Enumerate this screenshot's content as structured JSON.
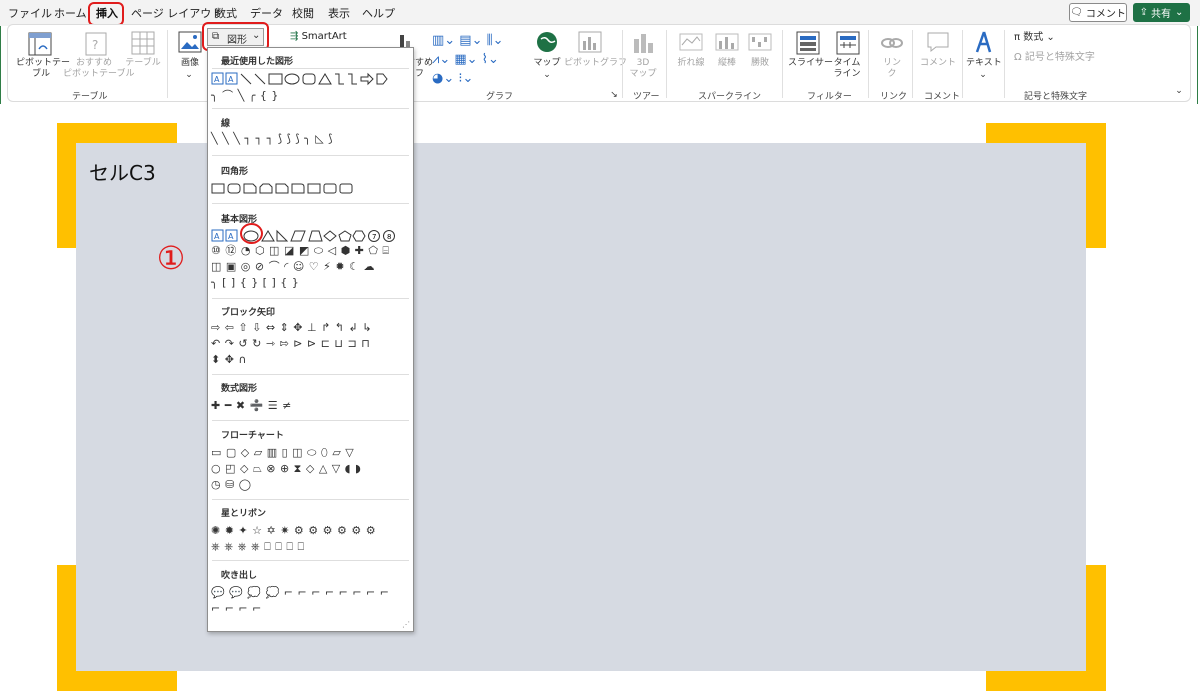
{
  "menu": {
    "tabs": [
      "ファイル",
      "ホーム",
      "挿入",
      "ページ レイアウト",
      "数式",
      "データ",
      "校閲",
      "表示",
      "ヘルプ"
    ],
    "active_tab": "挿入",
    "comment_btn": "コメント",
    "share_btn": "共有"
  },
  "ribbon": {
    "pivot_table": "ピボットテー\nブル",
    "recommended_pivot": "おすすめ\nピボットテーブル",
    "table": "テーブル",
    "group_table": "テーブル",
    "image": "画像",
    "shapes_btn": "図形",
    "smartart": "SmartArt",
    "recommended_chart": "すすめ\nラフ",
    "map": "マップ",
    "pivot_chart": "ピボットグラフ",
    "group_chart": "グラフ",
    "map3d": "3D\nマップ",
    "group_tour": "ツアー",
    "line": "折れ線",
    "column": "縦棒",
    "winloss": "勝敗",
    "group_spark": "スパークライン",
    "slicer": "スライサー",
    "timeline": "タイム\nライン",
    "group_filter": "フィルター",
    "link": "リン\nク",
    "group_link": "リンク",
    "comment": "コメント",
    "group_comment": "コメント",
    "text": "テキスト",
    "equation": "数式",
    "symbol": "記号と特殊文字",
    "group_symbol": "記号と特殊文字"
  },
  "dropdown": {
    "sections": [
      {
        "title": "最近使用した図形",
        "rows": [
          "",
          "╮ ⌒ ╲ ╭ {  }"
        ]
      },
      {
        "title": "線",
        "rows": [
          "╲ ╲ ╲ ┐ ┐ ┐ ⟆ ⟆ ⟆ ╮ ◺ ⟆"
        ]
      },
      {
        "title": "四角形",
        "rows": [
          ""
        ]
      },
      {
        "title": "基本図形",
        "rows": [
          "",
          "⑩ ⑫ ◔ ⬡ ◫ ◪ ◩ ⬭ ◁ ⬢ ✚ ⬠ ⌸",
          "◫ ▣ ◎ ⊘ ⌒ ◜ ☺ ♡ ⚡ ✹ ☾ ☁",
          "╮ [ ] { } [   ] {   }"
        ]
      },
      {
        "title": "ブロック矢印",
        "rows": [
          "⇨ ⇦ ⇧ ⇩ ⇔ ⇕ ✥ ⊥ ↱ ↰ ↲ ↳",
          "↶ ↷ ↺ ↻ ⇾ ⇰ ⊳ ⊳ ⊏ ⊔ ⊐ ⊓",
          "⬍ ✥ ∩"
        ]
      },
      {
        "title": "数式図形",
        "rows": [
          "✚ ━ ✖ ➗ ☰ ≠"
        ]
      },
      {
        "title": "フローチャート",
        "rows": [
          "▭ ▢ ◇ ▱ ▥ ▯ ◫ ⬭ ⬯ ▱ ▽",
          "○ ◰ ◇ ⏢ ⊗ ⊕ ⧗ ◇ △ ▽ ◖ ◗",
          "◷ ⛁ ◯"
        ]
      },
      {
        "title": "星とリボン",
        "rows": [
          "✺ ✹ ✦ ☆ ✡ ✷ ⚙ ⚙ ⚙ ⚙ ⚙ ⚙",
          "⎈ ⎈ ⎈ ⎈ ⎕ ⎕ ⎕ ⎕"
        ]
      },
      {
        "title": "吹き出し",
        "rows": [
          "💬 💬 💭 💭 ⌐ ⌐ ⌐ ⌐ ⌐ ⌐ ⌐ ⌐",
          "⌐ ⌐ ⌐ ⌐"
        ]
      }
    ]
  },
  "sheet": {
    "cell_label": "セルC3",
    "step_marker": "①"
  },
  "colors": {
    "accent_red": "#e01c1c",
    "corner_yellow": "#ffc000",
    "gray_fill": "#d6dae2",
    "share_green": "#1e7145"
  }
}
